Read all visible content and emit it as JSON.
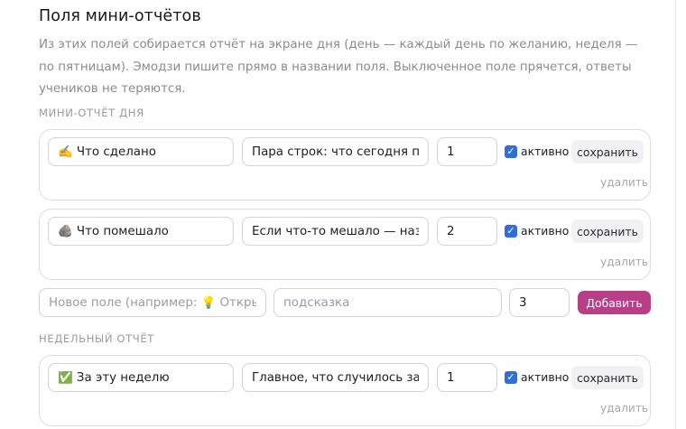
{
  "section": {
    "title": "Поля мини-отчётов",
    "description": "Из этих полей собирается отчёт на экране дня (день — каждый день по желанию, неделя — по пятницам). Эмодзи пишите прямо в названии поля. Выключенное поле прячется, ответы учеников не теряются."
  },
  "daily": {
    "label": "МИНИ-ОТЧЁТ ДНЯ",
    "fields": [
      {
        "name": "✍️ Что сделано",
        "hint": "Пара строк: что сегодня по",
        "order": "1",
        "active_label": "активно",
        "save_label": "сохранить",
        "delete_label": "удалить"
      },
      {
        "name": "🪨 Что помешало",
        "hint": "Если что-то мешало — назо",
        "order": "2",
        "active_label": "активно",
        "save_label": "сохранить",
        "delete_label": "удалить"
      }
    ],
    "new_field": {
      "name_placeholder": "Новое поле (например: 💡 Открыт",
      "hint_placeholder": "подсказка",
      "order": "3",
      "add_label": "Добавить"
    }
  },
  "weekly": {
    "label": "НЕДЕЛЬНЫЙ ОТЧЁТ",
    "fields": [
      {
        "name": "✅ За эту неделю",
        "hint": "Главное, что случилось за н",
        "order": "1",
        "active_label": "активно",
        "save_label": "сохранить",
        "delete_label": "удалить"
      }
    ]
  },
  "colors": {
    "accent": "#b83f86",
    "checkbox": "#2f6fd6"
  }
}
